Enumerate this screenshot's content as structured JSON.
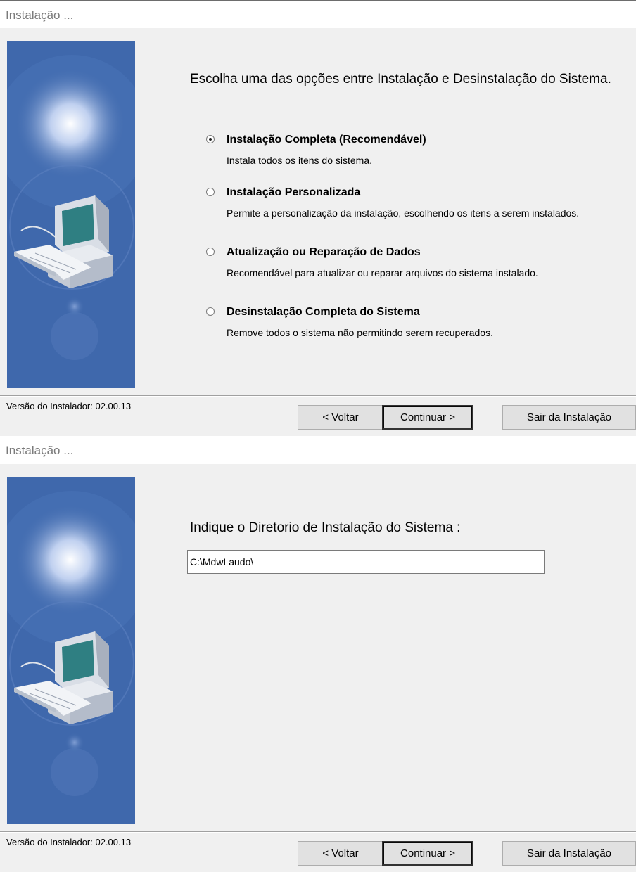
{
  "window_title": "Instalação ...",
  "version_label": "Versão do Instalador: 02.00.13",
  "buttons": {
    "back": "< Voltar",
    "next": "Continuar >",
    "exit": "Sair da Instalação"
  },
  "step1": {
    "heading": "Escolha uma das opções entre Instalação e Desinstalação do Sistema.",
    "selected_option": "full_install",
    "options": [
      {
        "id": "full_install",
        "label": "Instalação Completa (Recomendável)",
        "desc": "Instala todos os itens do sistema.",
        "checked": true
      },
      {
        "id": "custom_install",
        "label": "Instalação Personalizada",
        "desc": "Permite a personalização da instalação, escolhendo os itens a serem instalados.",
        "checked": false
      },
      {
        "id": "update_repair",
        "label": "Atualização ou Reparação de Dados",
        "desc": "Recomendável para atualizar ou reparar arquivos do sistema instalado.",
        "checked": false
      },
      {
        "id": "uninstall",
        "label": "Desinstalação Completa do Sistema",
        "desc": "Remove todos o sistema não permitindo serem recuperados.",
        "checked": false
      }
    ]
  },
  "step2": {
    "prompt": "Indique o Diretorio de Instalação do Sistema :",
    "directory_value": "C:\\MdwLaudo\\"
  },
  "icons": [
    "computer-illustration"
  ],
  "colors": {
    "side_panel": "#3f68ac",
    "background": "#f0f0f0"
  }
}
